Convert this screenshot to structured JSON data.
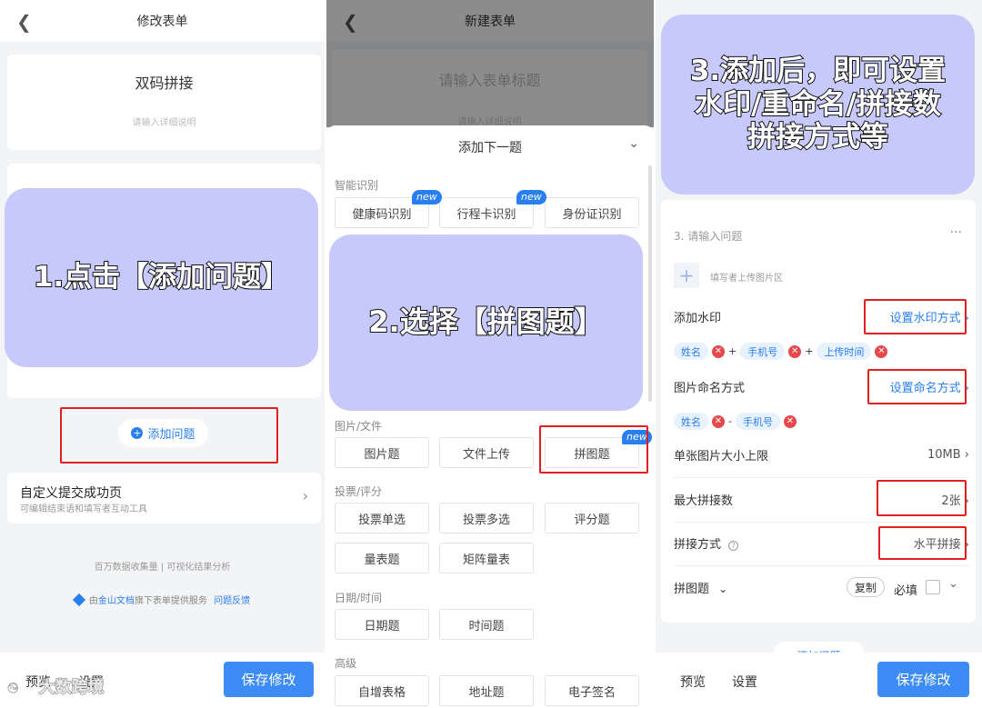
{
  "panel1": {
    "header_title": "修改表单",
    "form_title": "双码拼接",
    "form_desc_placeholder": "请输入详细说明",
    "callout": "1.点击【添加问题】",
    "add_question": "添加问题",
    "custom_success_title": "自定义提交成功页",
    "custom_success_sub": "可编辑结束语和填写者互动工具",
    "footer_line1": "百万数据收集量 | 可视化结果分析",
    "footer_line2_prefix": "由",
    "footer_brand": "金山文档",
    "footer_line2_mid": "旗下表单提供服务",
    "footer_feedback": "问题反馈",
    "preview": "预览",
    "settings": "设置",
    "save": "保存修改",
    "watermark": "大数跨境"
  },
  "panel2": {
    "header_title": "新建表单",
    "title_placeholder": "请输入表单标题",
    "desc_placeholder": "请输入详细说明",
    "sheet_title": "添加下一题",
    "callout": "2.选择【拼图题】",
    "new_badge": "new",
    "sections": {
      "smart": "智能识别",
      "image": "图片/文件",
      "vote": "投票/评分",
      "date": "日期/时间",
      "advanced": "高级"
    },
    "smart_items": [
      "健康码识别",
      "行程卡识别",
      "身份证识别"
    ],
    "image_items": [
      "图片题",
      "文件上传",
      "拼图题"
    ],
    "vote_items": [
      "投票单选",
      "投票多选",
      "评分题",
      "量表题",
      "矩阵量表"
    ],
    "date_items": [
      "日期题",
      "时间题"
    ],
    "advanced_items": [
      "自增表格",
      "地址题",
      "电子签名"
    ]
  },
  "panel3": {
    "callout_l1": "3.添加后，即可设置",
    "callout_l2": "水印/重命名/拼接数",
    "callout_l3": "拼接方式等",
    "question_placeholder": "3.  请输入问题",
    "more": "···",
    "upload_hint": "填写者上传图片区",
    "watermark_label": "添加水印",
    "watermark_link": "设置水印方式",
    "watermark_chips": [
      "姓名",
      "手机号",
      "上传时间"
    ],
    "naming_label": "图片命名方式",
    "naming_link": "设置命名方式",
    "naming_chips": [
      "姓名",
      "手机号"
    ],
    "size_label": "单张图片大小上限",
    "size_value": "10MB",
    "max_label": "最大拼接数",
    "max_value": "2张",
    "method_label": "拼接方式",
    "method_value": "水平拼接",
    "type_label": "拼图题",
    "copy": "复制",
    "required": "必填",
    "add_question_partial": "添加问题",
    "preview": "预览",
    "settings": "设置",
    "save": "保存修改"
  }
}
